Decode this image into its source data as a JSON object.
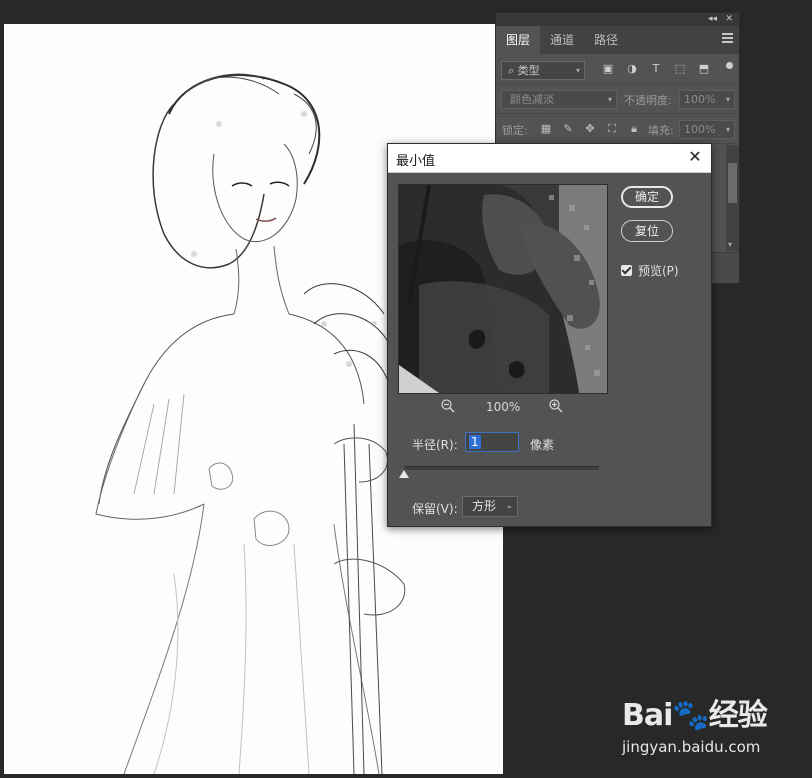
{
  "layers_panel": {
    "tabs": [
      {
        "label": "图层",
        "active": true
      },
      {
        "label": "通道",
        "active": false
      },
      {
        "label": "路径",
        "active": false
      }
    ],
    "filter_kind": "类型",
    "blend_mode": "颜色减淡",
    "opacity_label": "不透明度:",
    "opacity_value": "100%",
    "lock_label": "锁定:",
    "fill_label": "填充:",
    "fill_value": "100%"
  },
  "dialog": {
    "title": "最小值",
    "close_symbol": "✕",
    "ok_label": "确定",
    "reset_label": "复位",
    "preview_label": "预览(P)",
    "preview_checked": true,
    "zoom_value": "100%",
    "radius_label": "半径(R):",
    "radius_value": "1",
    "radius_unit": "像素",
    "radius_slider_fraction": 0.0,
    "preserve_label": "保留(V):",
    "preserve_value": "方形"
  },
  "watermark": {
    "logo_text": "Bai🐾经验",
    "url": "jingyan.baidu.com"
  },
  "colors": {
    "workspace_bg": "#282828",
    "panel_bg": "#535353",
    "accent_blue": "#3b72c4"
  }
}
